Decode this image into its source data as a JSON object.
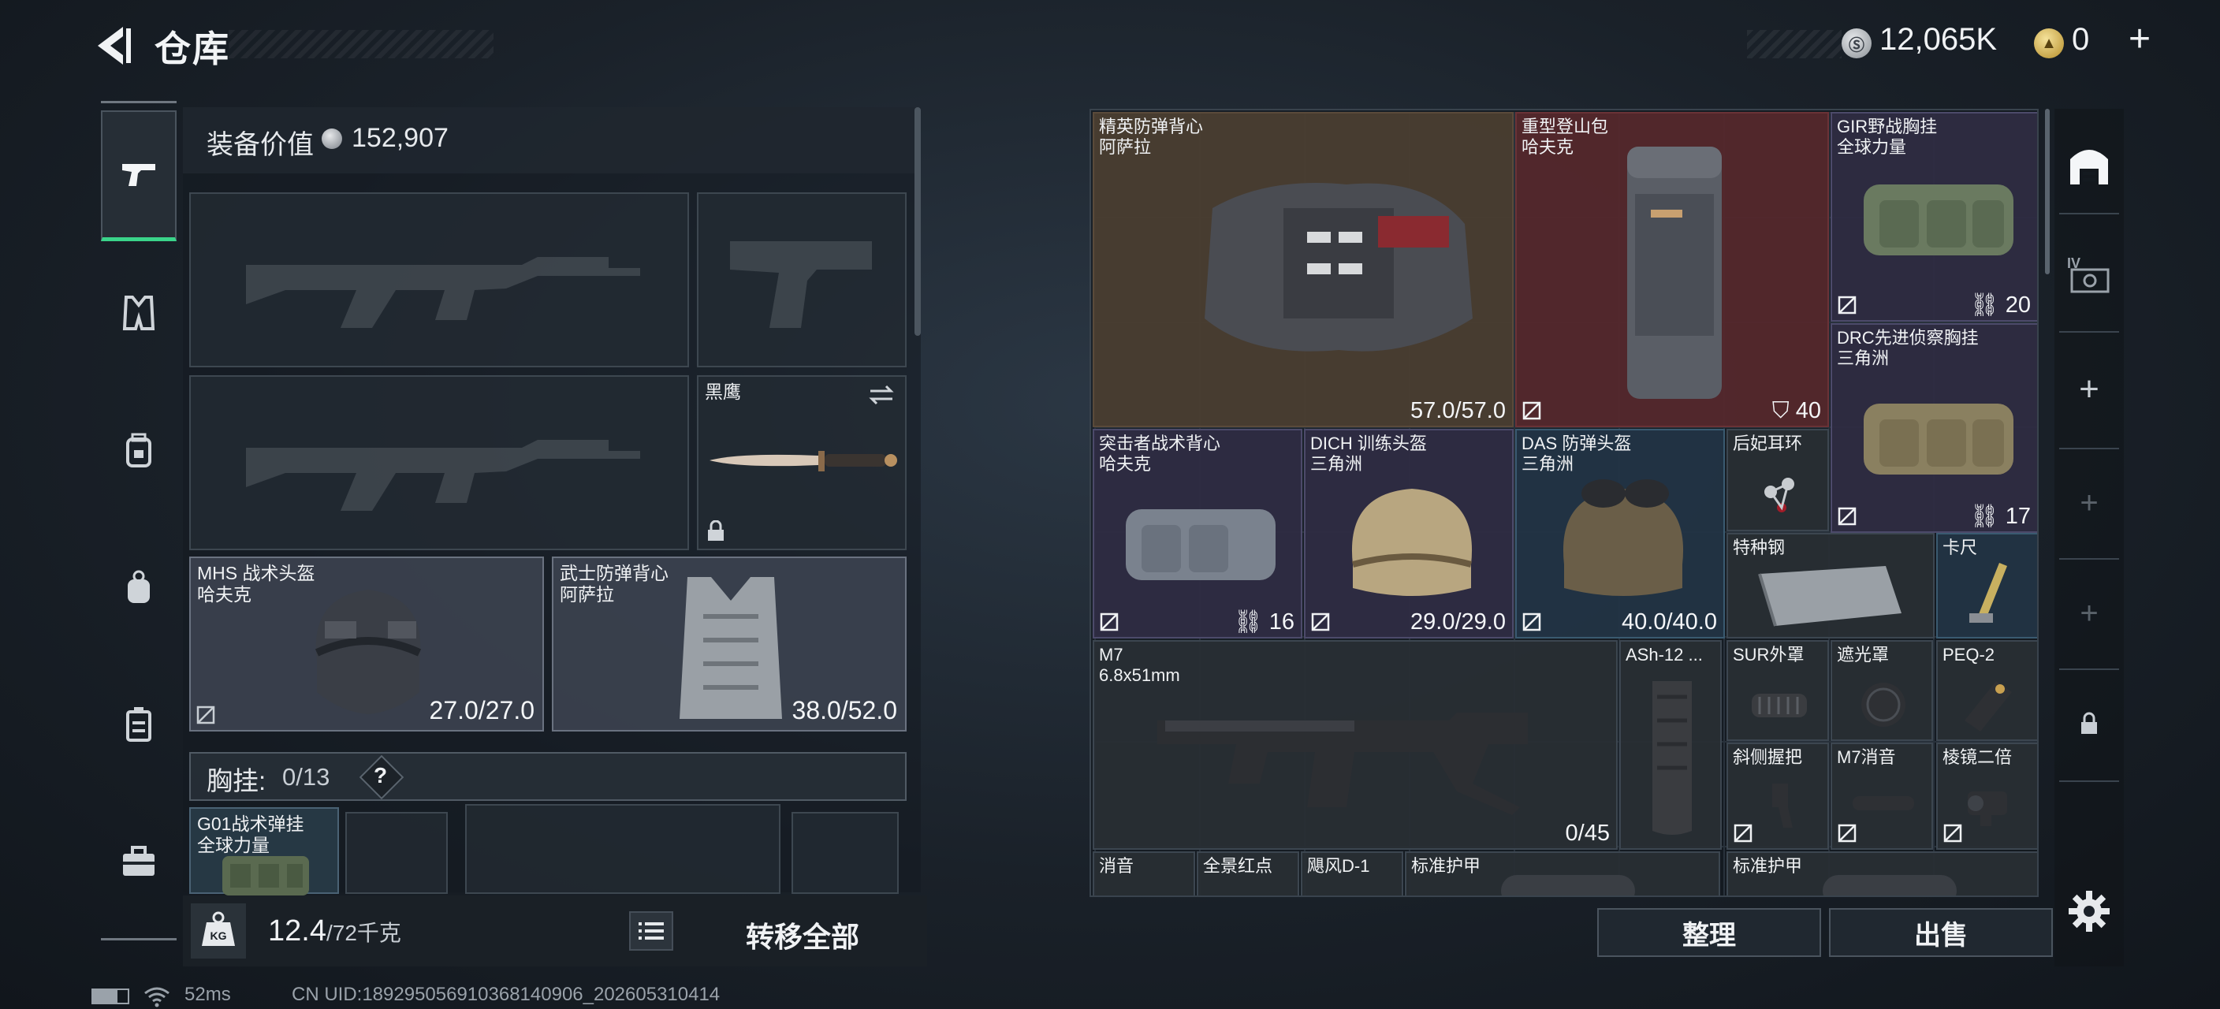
{
  "header": {
    "title": "仓库",
    "currency1": "12,065K",
    "currency2": "0",
    "plus": "+",
    "coin1_label": "Ⓢ",
    "coin2_label": "▲"
  },
  "nav": [
    {
      "name": "weapon"
    },
    {
      "name": "vest"
    },
    {
      "name": "backpack"
    },
    {
      "name": "pouch"
    },
    {
      "name": "case"
    },
    {
      "name": "toolbox"
    }
  ],
  "equipment": {
    "value_label": "装备价值",
    "value": "152,907",
    "knife": {
      "title": "黑鹰"
    },
    "helmet": {
      "title": "MHS 战术头盔",
      "sub": "哈夫克",
      "durability": "27.0/27.0"
    },
    "armor": {
      "title": "武士防弹背心",
      "sub": "阿萨拉",
      "durability": "38.0/52.0"
    },
    "chest_rig": {
      "label": "胸挂:",
      "count": "0/13",
      "help": "?"
    },
    "rig_item": {
      "title": "G01战术弹挂",
      "sub": "全球力量"
    }
  },
  "bottom": {
    "weight": "12.4",
    "weight_max": "/72千克",
    "transfer": "转移全部"
  },
  "status": {
    "ping": "52ms",
    "uid": "CN UID:1892950569103681409​06_202605310414"
  },
  "inventory": {
    "items": [
      {
        "title": "精英防弹背心",
        "sub": "阿萨拉",
        "value": "57.0/57.0"
      },
      {
        "title": "重型登山包",
        "sub": "哈夫克",
        "value": "40"
      },
      {
        "title": "GIR野战胸挂",
        "sub": "全球力量",
        "value": "20"
      },
      {
        "title": "DRC先进侦察胸挂",
        "sub": "三角洲",
        "value": "17"
      },
      {
        "title": "突击者战术背心",
        "sub": "哈夫克",
        "value": "16"
      },
      {
        "title": "DICH 训练头盔",
        "sub": "三角洲",
        "value": "29.0/29.0"
      },
      {
        "title": "DAS 防弹头盔",
        "sub": "三角洲",
        "value": "40.0/40.0"
      },
      {
        "title": "后妃耳环",
        "sub": ""
      },
      {
        "title": "特种钢",
        "sub": ""
      },
      {
        "title": "卡尺",
        "sub": ""
      },
      {
        "title": "M7",
        "sub": "6.8x51mm",
        "value": "0/45"
      },
      {
        "title": "ASh-12 ...",
        "sub": ""
      },
      {
        "title": "SUR外罩",
        "sub": ""
      },
      {
        "title": "遮光罩",
        "sub": ""
      },
      {
        "title": "PEQ-2",
        "sub": ""
      },
      {
        "title": "斜侧握把",
        "sub": ""
      },
      {
        "title": "M7消音",
        "sub": ""
      },
      {
        "title": "棱镜二倍",
        "sub": ""
      },
      {
        "title": "消音",
        "sub": ""
      },
      {
        "title": "全景红点",
        "sub": ""
      },
      {
        "title": "飓风D-1",
        "sub": ""
      },
      {
        "title": "标准护甲",
        "sub": ""
      },
      {
        "title": "标准护甲",
        "sub": ""
      }
    ]
  },
  "actions": {
    "sort": "整理",
    "sell": "出售"
  },
  "colors": {
    "accent": "#3ad48a",
    "rarity_brown": "#4a3e30",
    "rarity_red": "#54282c",
    "rarity_purple": "#2e2c42",
    "rarity_blue": "#223444"
  }
}
